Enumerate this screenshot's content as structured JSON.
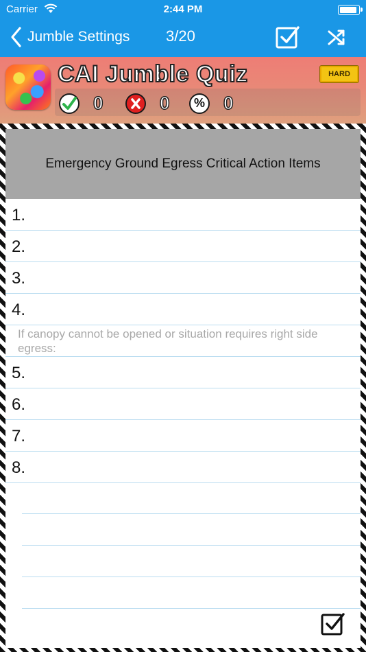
{
  "status_bar": {
    "carrier": "Carrier",
    "time": "2:44 PM"
  },
  "nav": {
    "back_label": "Jumble Settings",
    "counter": "3/20"
  },
  "header": {
    "title": "CAI Jumble  Quiz",
    "difficulty": "HARD",
    "scores": {
      "correct": "0",
      "wrong": "0",
      "percent": "0"
    }
  },
  "quiz": {
    "title": "Emergency Ground Egress Critical Action Items",
    "items_a": [
      "1.",
      "2.",
      "3.",
      "4."
    ],
    "note": "If canopy cannot be opened or situation requires right side egress:",
    "items_b": [
      "5.",
      "6.",
      "7.",
      "8."
    ]
  },
  "colors": {
    "nav_blue": "#1a97e6",
    "header_gray": "#a6a6a6",
    "rule_blue": "#b9dcf0"
  }
}
